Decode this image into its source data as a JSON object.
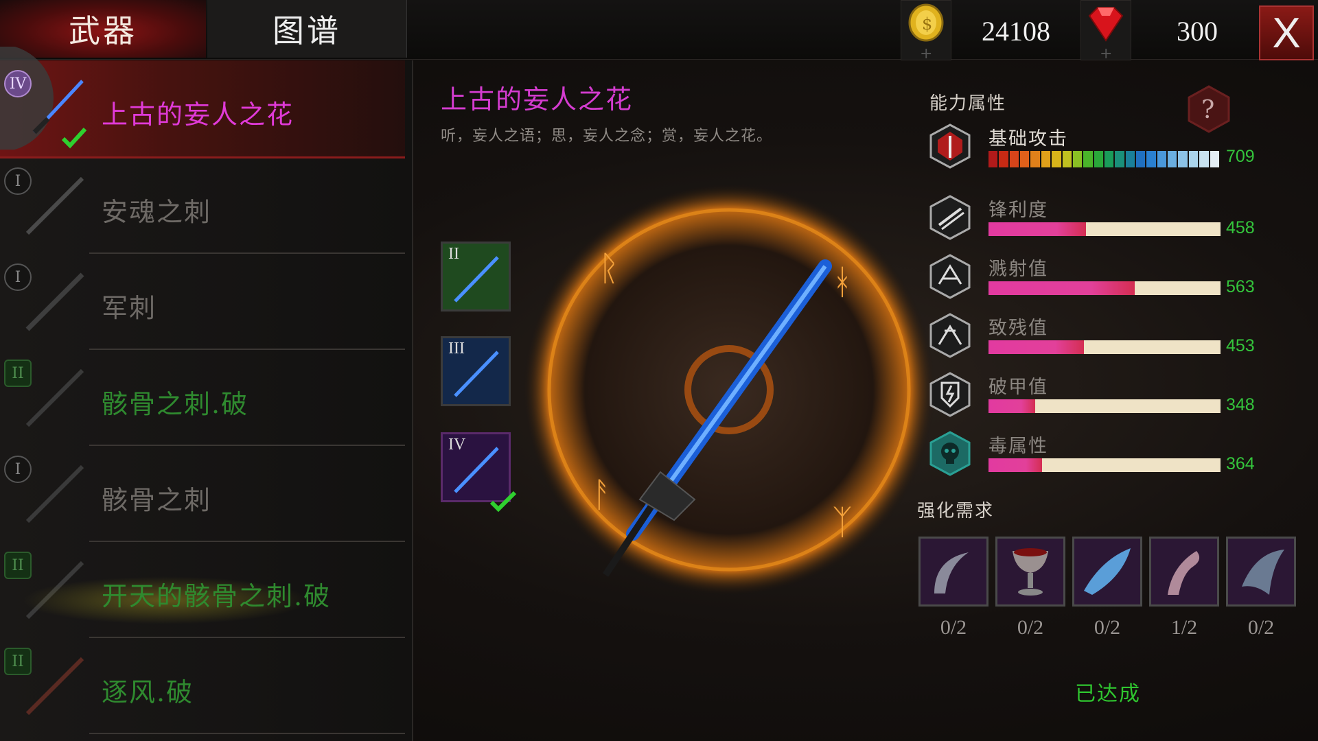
{
  "tabs": {
    "weapons": "武器",
    "codex": "图谱"
  },
  "resources": {
    "coins": "24108",
    "gems": "300"
  },
  "close_label": "X",
  "weapon_list": [
    {
      "tier": "IV",
      "name": "上古的妄人之花",
      "state": "selected",
      "owned": true
    },
    {
      "tier": "I",
      "name": "安魂之刺",
      "state": "locked"
    },
    {
      "tier": "I",
      "name": "军刺",
      "state": "locked"
    },
    {
      "tier": "II",
      "name": "骸骨之刺.破",
      "state": "green"
    },
    {
      "tier": "I",
      "name": "骸骨之刺",
      "state": "locked"
    },
    {
      "tier": "II",
      "name": "开天的骸骨之刺.破",
      "state": "green"
    },
    {
      "tier": "II",
      "name": "逐风.破",
      "state": "green"
    }
  ],
  "weapon_detail": {
    "title": "上古的妄人之花",
    "description": "听，妄人之语；思，妄人之念；赏，妄人之花。",
    "stages": [
      {
        "label": "II",
        "color": "#1f4a1f"
      },
      {
        "label": "III",
        "color": "#13284a"
      },
      {
        "label": "IV",
        "color": "#2a1240",
        "owned": true
      }
    ]
  },
  "stats": {
    "title": "能力属性",
    "help_icon": "question-icon",
    "items": [
      {
        "name": "基础攻击",
        "value": "709",
        "fraction": 1.0,
        "icon": "attack-icon",
        "rainbow": true
      },
      {
        "name": "锋利度",
        "value": "458",
        "fraction": 0.42,
        "icon": "sharpness-icon"
      },
      {
        "name": "溅射值",
        "value": "563",
        "fraction": 0.63,
        "icon": "splash-icon"
      },
      {
        "name": "致残值",
        "value": "453",
        "fraction": 0.41,
        "icon": "cripple-icon"
      },
      {
        "name": "破甲值",
        "value": "348",
        "fraction": 0.2,
        "icon": "armor-break-icon"
      },
      {
        "name": "毒属性",
        "value": "364",
        "fraction": 0.23,
        "icon": "poison-skull-icon"
      }
    ]
  },
  "upgrade": {
    "title": "强化需求",
    "materials": [
      {
        "icon": "claw-icon",
        "count": "0/2"
      },
      {
        "icon": "chalice-icon",
        "count": "0/2"
      },
      {
        "icon": "crystal-icon",
        "count": "0/2"
      },
      {
        "icon": "fang-icon",
        "count": "1/2"
      },
      {
        "icon": "fin-icon",
        "count": "0/2"
      }
    ],
    "status": "已达成"
  },
  "colors": {
    "accent": "#d43cd0",
    "value_green": "#34c53c",
    "tab_red": "#8a1414"
  }
}
